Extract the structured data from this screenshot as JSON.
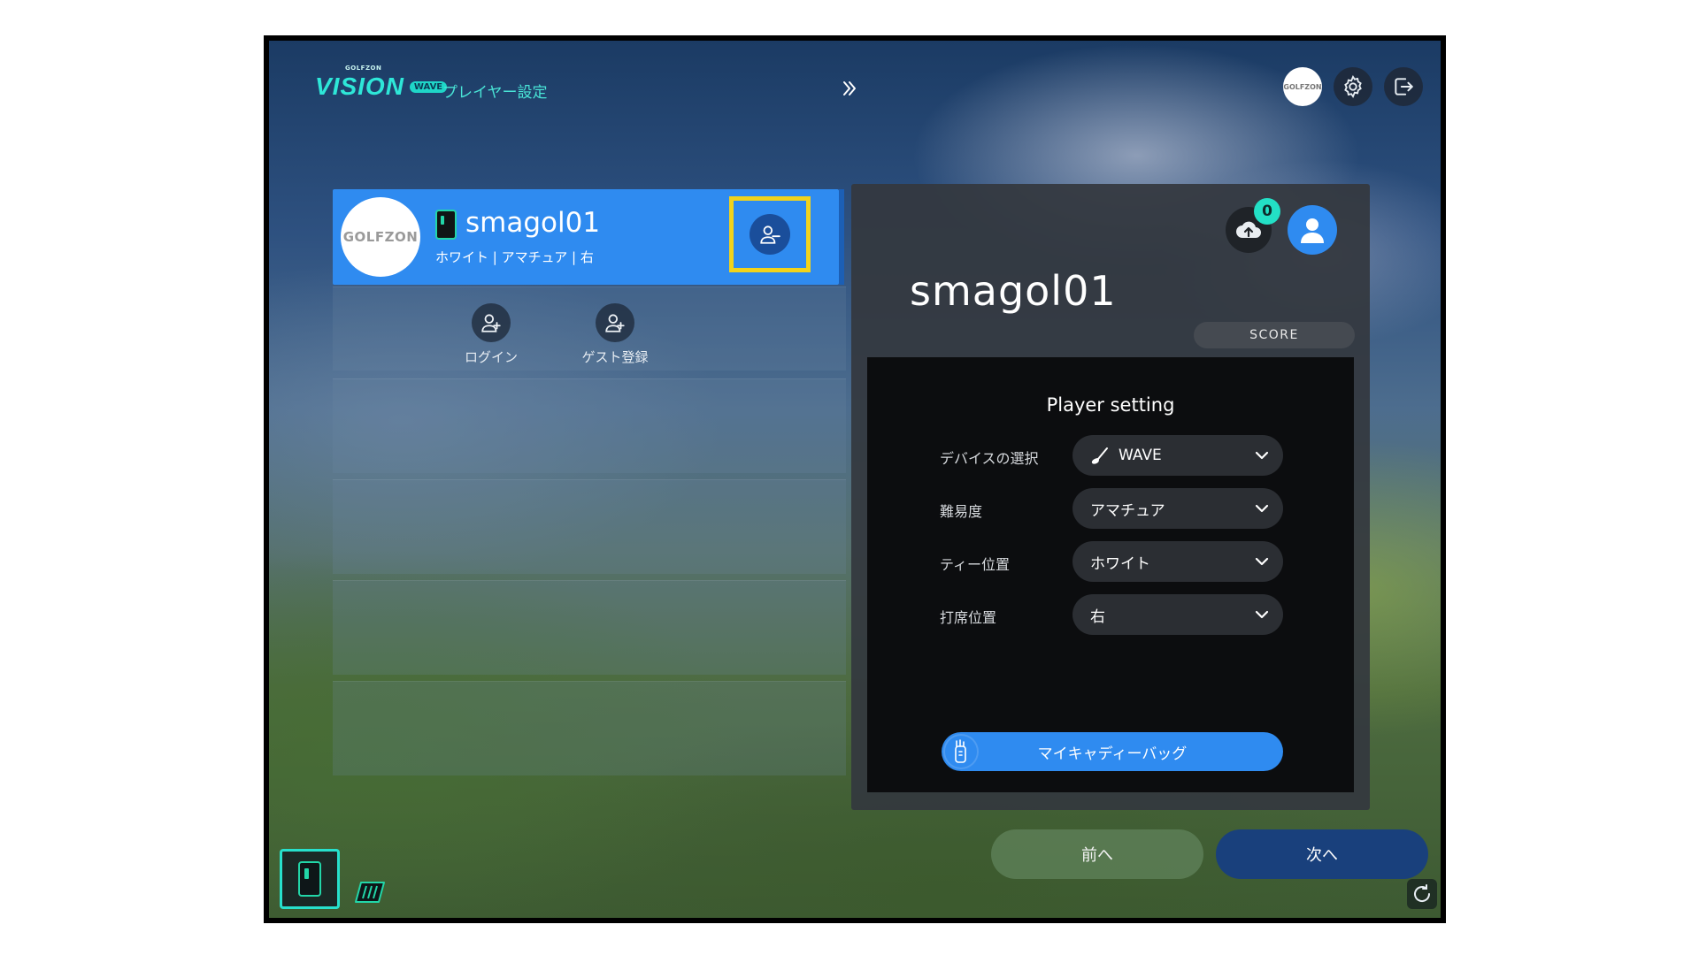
{
  "header": {
    "logo_top": "GOLFZON",
    "logo_main": "VISION",
    "logo_badge": "WAVE",
    "page_title": "プレイヤー設定",
    "brand_button_text": "GOLFZON"
  },
  "player_card": {
    "avatar_text": "GOLFZON",
    "name": "smagol01",
    "details": "ホワイト | アマチュア | 右",
    "remove_icon": "user-minus-icon"
  },
  "actions": {
    "login_label": "ログイン",
    "guest_label": "ゲスト登録"
  },
  "panel": {
    "upload_count": "0",
    "player_name": "smagol01",
    "score_tab": "SCORE",
    "settings_title": "Player setting",
    "rows": [
      {
        "label": "デバイスの選択",
        "value": "WAVE"
      },
      {
        "label": "難易度",
        "value": "アマチュア"
      },
      {
        "label": "ティー位置",
        "value": "ホワイト"
      },
      {
        "label": "打席位置",
        "value": "右"
      }
    ],
    "caddie_button": "マイキャディーバッグ"
  },
  "footer": {
    "prev_label": "前へ",
    "next_label": "次へ"
  },
  "colors": {
    "accent": "#2f8bf0",
    "teal": "#27e0cc",
    "highlight": "#f1d31c",
    "next_button": "#19407c"
  }
}
